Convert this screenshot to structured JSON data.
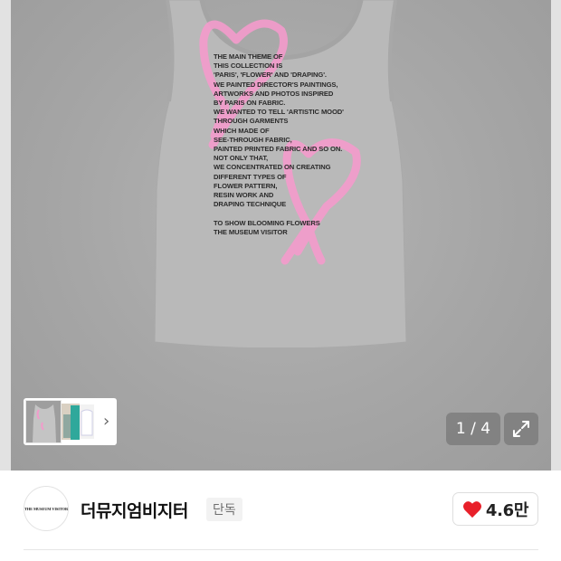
{
  "product": {
    "shirt_print_text": "THE MAIN THEME OF\nTHIS COLLECTION IS\n'PARIS', 'FLOWER' AND 'DRAPING'.\nWE PAINTED DIRECTOR'S PAINTINGS,\nARTWORKS AND PHOTOS INSPIRED\nBY PARIS ON FABRIC.\nWE WANTED TO TELL 'ARTISTIC MOOD'\nTHROUGH GARMENTS\nWHICH MADE OF\nSEE-THROUGH FABRIC,\nPAINTED PRINTED FABRIC AND SO ON.\nNOT ONLY THAT,\nWE CONCENTRATED ON CREATING\nDIFFERENT TYPES OF\nFLOWER PATTERN,\nRESIN WORK AND\nDRAPING TECHNIQUE\n\nTO SHOW BLOOMING FLOWERS\nTHE MUSEUM VISITOR",
    "print_color": "#f29bcb",
    "shirt_color": "#b9b9b9"
  },
  "gallery": {
    "counter": "1 / 4",
    "thumbs_arrow": "›"
  },
  "brand": {
    "logo_text": "THE MUSEUM VISITOR",
    "name": "더뮤지엄비지터",
    "badge": "단독",
    "likes": "4.6만"
  },
  "colors": {
    "like_heart": "#e8202a"
  }
}
